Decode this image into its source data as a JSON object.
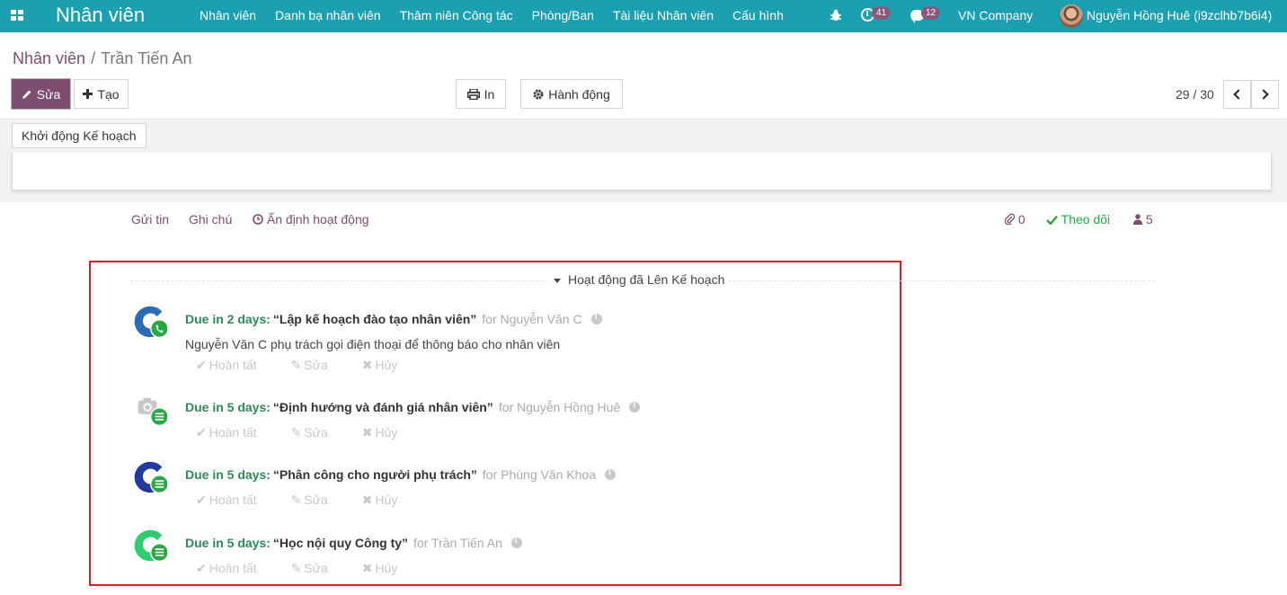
{
  "navbar": {
    "brand": "Nhân viên",
    "menu": [
      "Nhân viên",
      "Danh bạ nhân viên",
      "Thâm niên Công tác",
      "Phòng/Ban",
      "Tài liệu Nhân viên",
      "Cấu hình"
    ],
    "activity_count": "41",
    "message_count": "12",
    "company": "VN Company",
    "user": "Nguyễn Hồng Huê (i9zclhb7b6i4)",
    "color": "#1aa0b0"
  },
  "breadcrumb": {
    "parent": "Nhân viên",
    "separator": "/",
    "current": "Trần Tiến An"
  },
  "toolbar": {
    "edit": "Sửa",
    "create": "Tạo",
    "print": "In",
    "action": "Hành động"
  },
  "pager": {
    "value": "29 / 30"
  },
  "statusbar": {
    "launch_plan": "Khởi động Kế hoạch"
  },
  "chatter": {
    "send_message": "Gửi tin",
    "log_note": "Ghi chú",
    "schedule_activity": "Ấn định hoạt động",
    "attachments": "0",
    "follow": "Theo dõi",
    "followers": "5"
  },
  "planned": {
    "title": "Hoạt động đã Lên Kế hoạch",
    "actions": {
      "done": "Hoàn tất",
      "edit": "Sửa",
      "cancel": "Hủy"
    },
    "items": [
      {
        "due": "Due in 2 days:",
        "title": "“Lập kế hoạch đào tạo nhân viên”",
        "for": "for Nguyễn Văn C",
        "note": "Nguyễn Văn C phụ trách gọi điện thoại để thông báo cho nhân viên",
        "type_icon": "phone-icon",
        "avatar_color": "#2c6bb5"
      },
      {
        "due": "Due in 5 days:",
        "title": "“Định hướng và đánh giá nhân viên”",
        "for": "for Nguyễn Hồng Huê",
        "note": "",
        "type_icon": "list-icon",
        "avatar_color": "#c8c8c8"
      },
      {
        "due": "Due in 5 days:",
        "title": "“Phân công cho người phụ trách”",
        "for": "for Phùng Văn Khoa",
        "note": "",
        "type_icon": "list-icon",
        "avatar_color": "#23399b"
      },
      {
        "due": "Due in 5 days:",
        "title": "“Học nội quy Công ty”",
        "for": "for Trần Tiến An",
        "note": "",
        "type_icon": "list-icon",
        "avatar_color": "#2ecc71"
      }
    ]
  }
}
